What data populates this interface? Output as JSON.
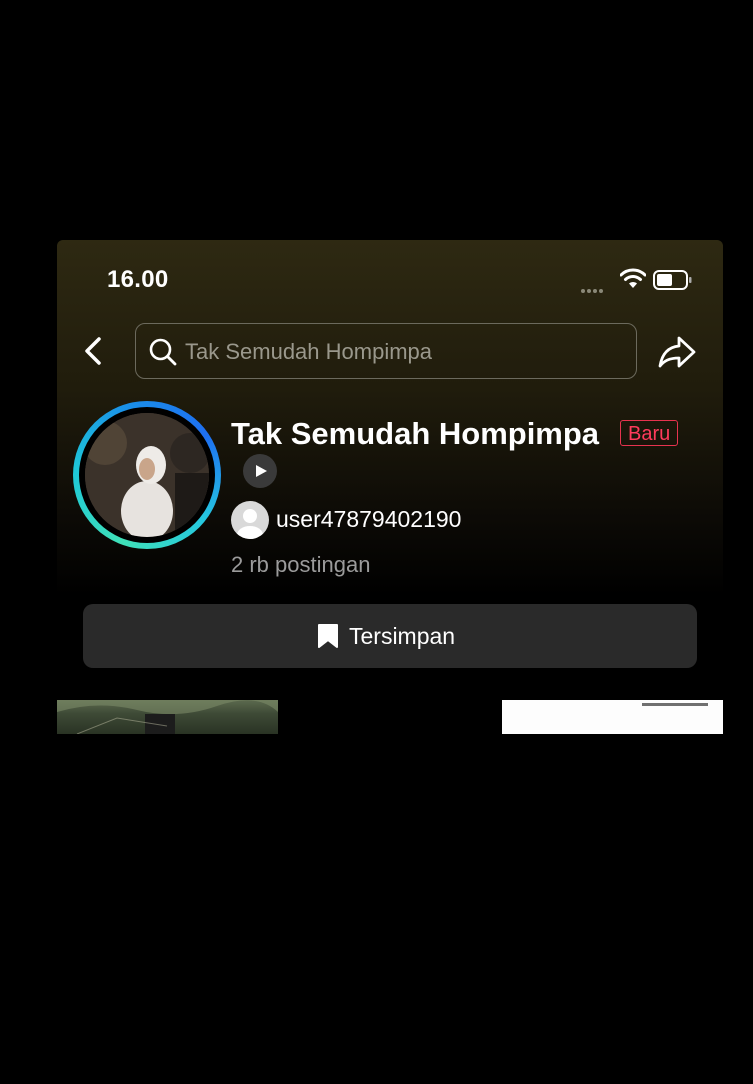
{
  "status_bar": {
    "time": "16.00"
  },
  "search": {
    "text": "Tak Semudah Hompimpa"
  },
  "profile": {
    "title": "Tak Semudah Hompimpa",
    "badge": "Baru",
    "username": "user47879402190",
    "post_count": "2 rb postingan"
  },
  "saved_button": {
    "label": "Tersimpan"
  },
  "colors": {
    "background": "#000000",
    "badge_red": "#ff3b5c",
    "ring_teal": "#3fe0b8",
    "ring_blue": "#1e6ff2",
    "button_bg": "#2a2a2a"
  },
  "icons": [
    "back-icon",
    "search-icon",
    "share-icon",
    "wifi-icon",
    "battery-icon",
    "play-icon",
    "bookmark-icon"
  ]
}
